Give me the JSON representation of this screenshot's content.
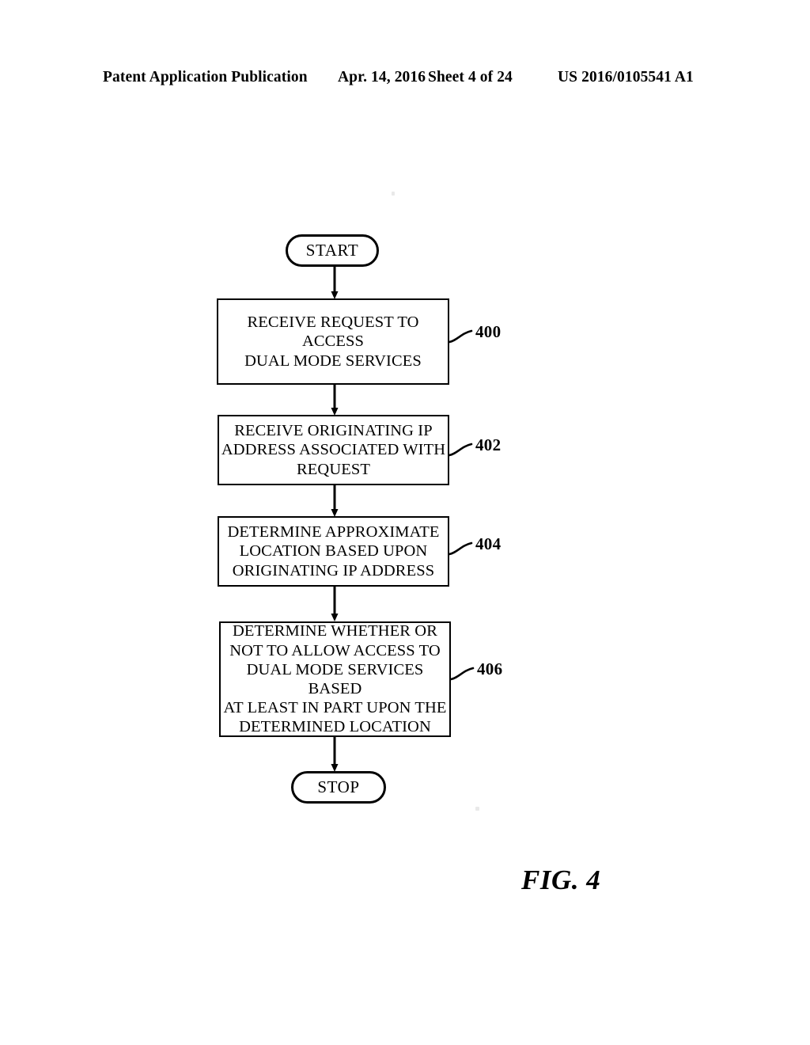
{
  "header": {
    "publication": "Patent Application Publication",
    "date": "Apr. 14, 2016",
    "sheet": "Sheet 4 of 24",
    "patent_number": "US 2016/0105541 A1"
  },
  "figure": {
    "caption": "FIG. 4",
    "type": "flowchart"
  },
  "flowchart": {
    "nodes": [
      {
        "id": "start",
        "shape": "terminator",
        "label": "START",
        "ref": null
      },
      {
        "id": "step-400",
        "shape": "process",
        "label": "RECEIVE REQUEST TO ACCESS\nDUAL MODE SERVICES",
        "ref": "400"
      },
      {
        "id": "step-402",
        "shape": "process",
        "label": "RECEIVE ORIGINATING IP\nADDRESS ASSOCIATED WITH\nREQUEST",
        "ref": "402"
      },
      {
        "id": "step-404",
        "shape": "process",
        "label": "DETERMINE APPROXIMATE\nLOCATION BASED UPON\nORIGINATING IP ADDRESS",
        "ref": "404"
      },
      {
        "id": "step-406",
        "shape": "process",
        "label": "DETERMINE WHETHER OR\nNOT TO ALLOW ACCESS TO\nDUAL MODE SERVICES BASED\nAT LEAST IN PART UPON THE\nDETERMINED LOCATION",
        "ref": "406"
      },
      {
        "id": "stop",
        "shape": "terminator",
        "label": "STOP",
        "ref": null
      }
    ],
    "edges": [
      {
        "from": "start",
        "to": "step-400"
      },
      {
        "from": "step-400",
        "to": "step-402"
      },
      {
        "from": "step-402",
        "to": "step-404"
      },
      {
        "from": "step-404",
        "to": "step-406"
      },
      {
        "from": "step-406",
        "to": "stop"
      }
    ],
    "colors": {
      "stroke": "#000000",
      "fill": "#ffffff",
      "text": "#000000"
    }
  }
}
